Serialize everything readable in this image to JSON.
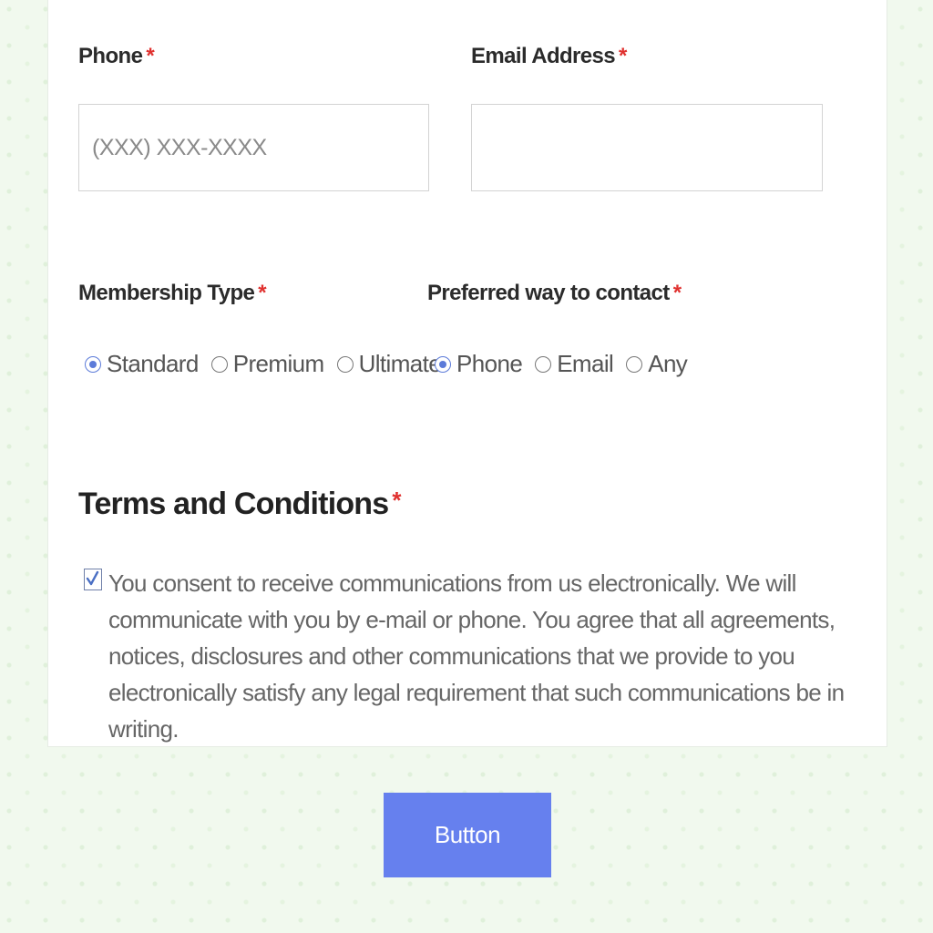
{
  "form": {
    "phone": {
      "label": "Phone",
      "required_mark": "*",
      "placeholder": "(XXX) XXX-XXXX",
      "value": ""
    },
    "email": {
      "label": "Email Address",
      "required_mark": "*",
      "placeholder": "",
      "value": ""
    },
    "membership": {
      "label": "Membership Type",
      "required_mark": "*",
      "options": [
        "Standard",
        "Premium",
        "Ultimate"
      ],
      "selected": "Standard"
    },
    "contact": {
      "label": "Preferred way to contact",
      "required_mark": "*",
      "options": [
        "Phone",
        "Email",
        "Any"
      ],
      "selected": "Phone"
    },
    "terms": {
      "title": "Terms and Conditions",
      "required_mark": "*",
      "checked": true,
      "text": "You consent to receive communications from us electronically. We will communicate with you by e-mail or phone. You agree that all agreements, notices, disclosures and other communications that we provide to you electronically satisfy any legal requirement that such communications be in writing."
    }
  },
  "submit_button": {
    "label": "Button"
  },
  "colors": {
    "accent": "#6680ee",
    "required": "#e0312f",
    "radio_checked": "#5c7bd9",
    "background": "#f1f9ee"
  }
}
